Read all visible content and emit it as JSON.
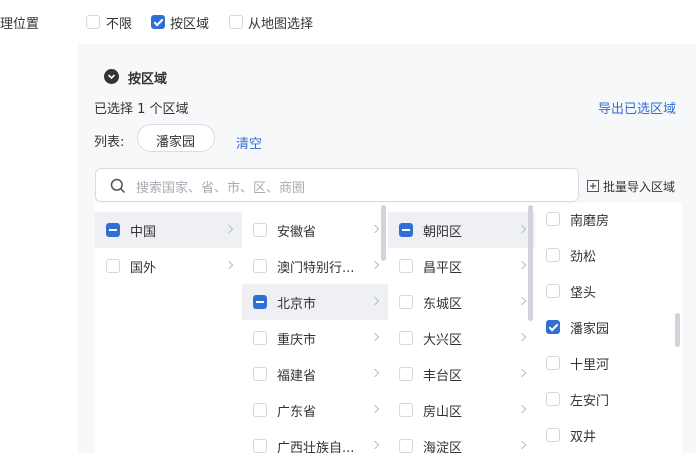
{
  "field_label": "理位置",
  "options": [
    {
      "label": "不限",
      "checked": false
    },
    {
      "label": "按区域",
      "checked": true
    },
    {
      "label": "从地图选择",
      "checked": false
    }
  ],
  "section_title": "按区域",
  "selected_summary": "已选择 1 个区域",
  "export_label": "导出已选区域",
  "list_label": "列表:",
  "selected_tag": "潘家园",
  "clear_label": "清空",
  "search_placeholder": "搜索国家、省、市、区、商圈",
  "bulk_import_label": "批量导入区域",
  "col1": [
    {
      "label": "中国",
      "state": "indeterminate",
      "active": true
    },
    {
      "label": "国外",
      "state": "unchecked",
      "active": false
    }
  ],
  "col2": [
    {
      "label": "安徽省",
      "state": "unchecked",
      "active": false
    },
    {
      "label": "澳门特别行...",
      "state": "unchecked",
      "active": false
    },
    {
      "label": "北京市",
      "state": "indeterminate",
      "active": true
    },
    {
      "label": "重庆市",
      "state": "unchecked",
      "active": false
    },
    {
      "label": "福建省",
      "state": "unchecked",
      "active": false
    },
    {
      "label": "广东省",
      "state": "unchecked",
      "active": false
    },
    {
      "label": "广西壮族自...",
      "state": "unchecked",
      "active": false
    }
  ],
  "col3": [
    {
      "label": "朝阳区",
      "state": "indeterminate",
      "active": true
    },
    {
      "label": "昌平区",
      "state": "unchecked",
      "active": false
    },
    {
      "label": "东城区",
      "state": "unchecked",
      "active": false
    },
    {
      "label": "大兴区",
      "state": "unchecked",
      "active": false
    },
    {
      "label": "丰台区",
      "state": "unchecked",
      "active": false
    },
    {
      "label": "房山区",
      "state": "unchecked",
      "active": false
    },
    {
      "label": "海淀区",
      "state": "unchecked",
      "active": false
    }
  ],
  "col4": [
    {
      "label": "南磨房",
      "state": "unchecked"
    },
    {
      "label": "劲松",
      "state": "unchecked"
    },
    {
      "label": "垡头",
      "state": "unchecked"
    },
    {
      "label": "潘家园",
      "state": "checked"
    },
    {
      "label": "十里河",
      "state": "unchecked"
    },
    {
      "label": "左安门",
      "state": "unchecked"
    },
    {
      "label": "双井",
      "state": "unchecked"
    }
  ],
  "colors": {
    "accent": "#2f6fd6",
    "panel_bg": "#f7f8fa"
  }
}
